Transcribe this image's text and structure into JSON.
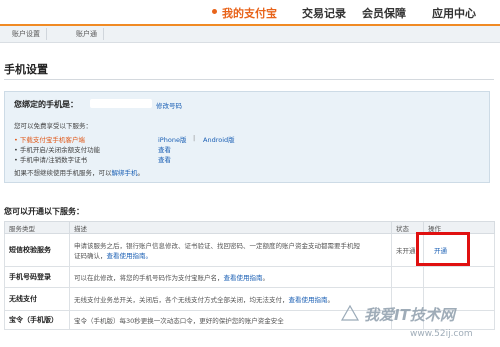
{
  "nav": {
    "items": [
      {
        "label": "我的支付宝",
        "active": true
      },
      {
        "label": "交易记录"
      },
      {
        "label": "会员保障"
      },
      {
        "label": "应用中心"
      }
    ]
  },
  "subtabs": [
    "账户设置",
    "账户通"
  ],
  "page_title": "手机设置",
  "bound": {
    "label": "您绑定的手机是：",
    "change_link": "修改号码",
    "free_intro": "您可以免费享受以下服务：",
    "items": [
      {
        "text": "• 下载支付宝手机客户端",
        "link1": "iPhone版",
        "sep": "|",
        "link2": "Android版"
      },
      {
        "text": "• 手机开启/关闭余额支付功能",
        "link1": "查看"
      },
      {
        "text": "• 手机申请/注销数字证书",
        "link1": "查看"
      }
    ],
    "unbind_prefix": "如果不想继续使用手机服务，可以",
    "unbind_link": "解绑手机",
    "unbind_suffix": "。"
  },
  "services": {
    "title": "您可以开通以下服务：",
    "headers": [
      "服务类型",
      "描述",
      "状态",
      "操作"
    ],
    "rows": [
      {
        "name": "短信校验服务",
        "desc1": "申请该服务之后，银行账户信息修改、证书验证、找回密码、一定额度的账户资金支动都需要手机短",
        "desc2": "证码确认，",
        "desc_link": "查看使用指南。",
        "status": "未开通",
        "action": "开通"
      },
      {
        "name": "手机号码登录",
        "desc1": "可以在此修改，将您的手机号码作为支付宝账户名，",
        "desc_link": "查看使用指南",
        "desc_end": "。",
        "status": "",
        "action": ""
      },
      {
        "name": "无线支付",
        "desc1": "无线支付业务总开关，关闭后，各个无线支付方式全部关闭，均无法支付，",
        "desc_link": "查看使用指南",
        "desc_end": "。",
        "status": "",
        "action": ""
      },
      {
        "name": "宝令（手机版）",
        "desc1": "宝令（手机版）每30秒更换一次动态口令，更好的保护您的账户资金安全",
        "status": "",
        "action": ""
      }
    ]
  },
  "watermark": {
    "line1": "我爱IT技术网",
    "line2": "www.52ij.com"
  }
}
